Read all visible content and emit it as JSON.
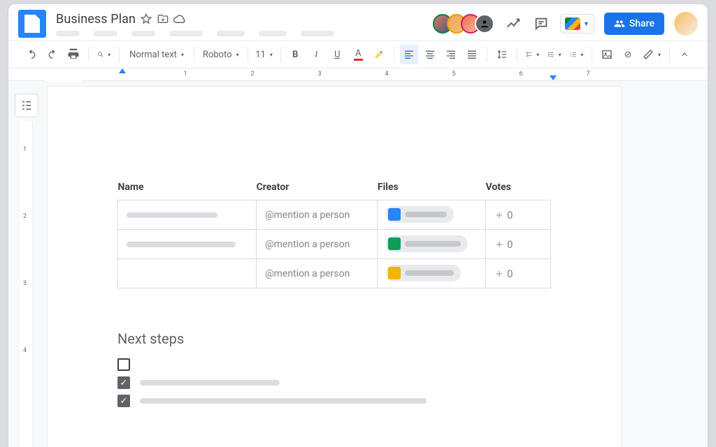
{
  "doc": {
    "title": "Business Plan"
  },
  "share": {
    "label": "Share"
  },
  "toolbar": {
    "style": "Normal text",
    "font": "Roboto",
    "size": "11"
  },
  "table": {
    "headers": {
      "name": "Name",
      "creator": "Creator",
      "files": "Files",
      "votes": "Votes"
    },
    "rows": [
      {
        "mention": "@mention a person",
        "votes": "0"
      },
      {
        "mention": "@mention a person",
        "votes": "0"
      },
      {
        "mention": "@mention a person",
        "votes": "0"
      }
    ]
  },
  "section": {
    "next_steps": "Next steps"
  },
  "ruler": {
    "n1": "1",
    "n2": "2",
    "n3": "3",
    "n4": "4",
    "n5": "5",
    "n6": "6",
    "n7": "7"
  },
  "vruler": {
    "n1": "1",
    "n2": "2",
    "n3": "3",
    "n4": "4"
  }
}
